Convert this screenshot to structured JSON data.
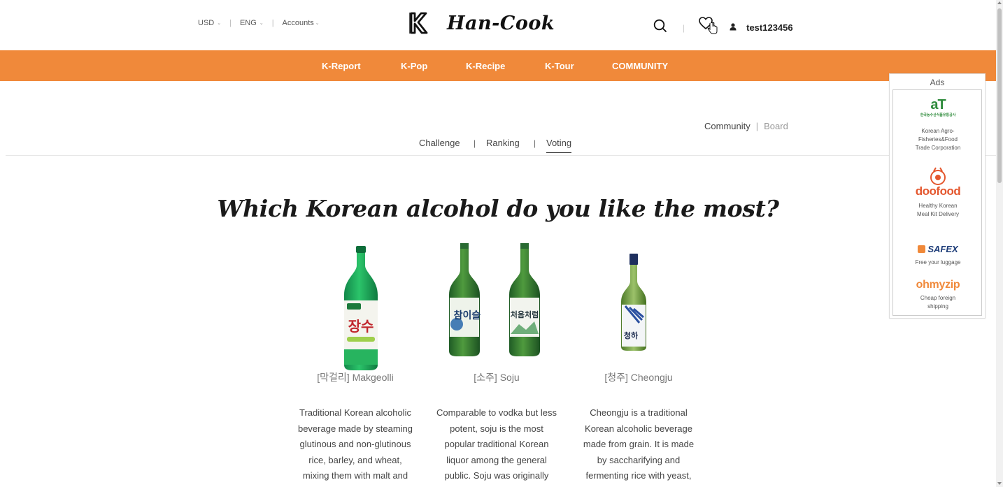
{
  "header": {
    "currency": "USD",
    "language": "ENG",
    "accounts": "Accounts",
    "brand": "Han-Cook",
    "username": "test123456"
  },
  "nav": {
    "items": [
      "K-Report",
      "K-Pop",
      "K-Recipe",
      "K-Tour",
      "COMMUNITY"
    ]
  },
  "breadcrumb": {
    "community": "Community",
    "board": "Board"
  },
  "tabs": [
    "Challenge",
    "Ranking",
    "Voting"
  ],
  "active_tab": "Voting",
  "page": {
    "title": "Which Korean alcohol do you like the most?"
  },
  "products": [
    {
      "name": "[막걸리] Makgeolli",
      "bottle_label": "장수",
      "desc": [
        "Traditional Korean alcoholic",
        "beverage made by steaming",
        "glutinous and non-glutinous",
        "rice, barley, and wheat,",
        "mixing them with malt and"
      ]
    },
    {
      "name": "[소주] Soju",
      "bottle_labels": [
        "참이슬",
        "처음처럼"
      ],
      "desc": [
        "Comparable to vodka but less",
        "potent, soju is the most",
        "popular traditional Korean",
        "liquor among the general",
        "public. Soju was originally"
      ]
    },
    {
      "name": "[청주] Cheongju",
      "bottle_label": "청하",
      "desc": [
        "Cheongju is a traditional",
        "Korean alcoholic beverage",
        "made from grain. It is made",
        "by saccharifying and",
        "fermenting rice with yeast,"
      ]
    }
  ],
  "ads": {
    "title": "Ads",
    "items": [
      {
        "logo": "aT",
        "logo_sub": "한국농수산식품유통공사",
        "desc": [
          "Korean Agro-",
          "Fisheries&Food",
          "Trade Corporation"
        ]
      },
      {
        "logo": "doofood",
        "desc": [
          "Healthy Korean",
          "Meal Kit Delivery"
        ]
      },
      {
        "logo": "SAFEX",
        "desc": [
          "Free your luggage"
        ]
      },
      {
        "logo": "ohmyzip",
        "desc": [
          "Cheap foreign",
          "shipping"
        ]
      }
    ]
  },
  "colors": {
    "nav_bg": "#f0893a",
    "bottle_green": "#2f8a3e",
    "makgeolli_green": "#1fa855"
  },
  "icons": [
    "k-logo-icon",
    "search-icon",
    "heart-icon",
    "hand-cursor-icon",
    "user-icon"
  ]
}
